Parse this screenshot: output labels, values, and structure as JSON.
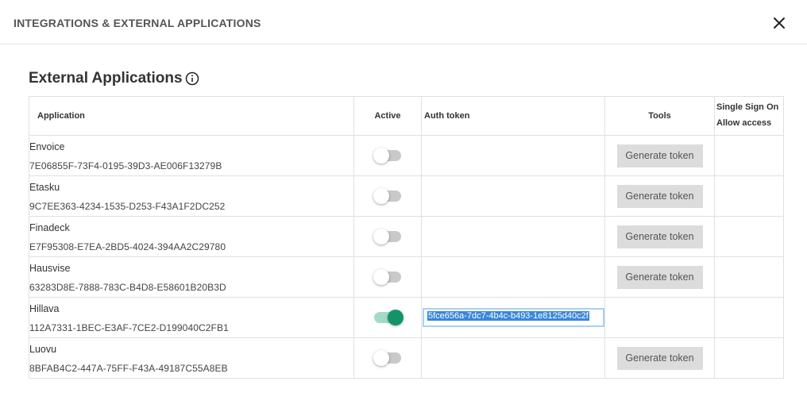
{
  "dialog": {
    "title": "INTEGRATIONS & EXTERNAL APPLICATIONS"
  },
  "section": {
    "title": "External Applications"
  },
  "table": {
    "headers": {
      "application": "Application",
      "active": "Active",
      "auth_token": "Auth token",
      "tools": "Tools",
      "sso_line1": "Single Sign On",
      "sso_line2": "Allow access"
    },
    "rows": [
      {
        "name": "Envoice",
        "id": "7E06855F-73F4-0195-39D3-AE006F13279B",
        "active": false,
        "token": "",
        "button": "Generate token"
      },
      {
        "name": "Etasku",
        "id": "9C7EE363-4234-1535-D253-F43A1F2DC252",
        "active": false,
        "token": "",
        "button": "Generate token"
      },
      {
        "name": "Finadeck",
        "id": "E7F95308-E7EA-2BD5-4024-394AA2C29780",
        "active": false,
        "token": "",
        "button": "Generate token"
      },
      {
        "name": "Hausvise",
        "id": "63283D8E-7888-783C-B4D8-E58601B20B3D",
        "active": false,
        "token": "",
        "button": "Generate token"
      },
      {
        "name": "Hillava",
        "id": "112A7331-1BEC-E3AF-7CE2-D199040C2FB1",
        "active": true,
        "token": "5fce656a-7dc7-4b4c-b493-1e8125d40c2f",
        "button": ""
      },
      {
        "name": "Luovu",
        "id": "8BFAB4C2-447A-75FF-F43A-49187C55A8EB",
        "active": false,
        "token": "",
        "button": "Generate token"
      }
    ]
  },
  "colors": {
    "toggle_on": "#15926a",
    "toggle_on_track": "#a3dcc6",
    "toggle_off_track": "#c9c9c9",
    "selection": "#3a87d8"
  },
  "icons": {
    "close": "close-icon",
    "info": "info-icon"
  }
}
